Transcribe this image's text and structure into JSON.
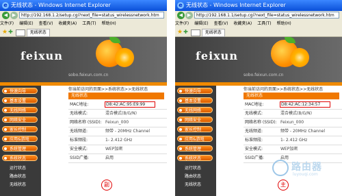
{
  "panels": [
    {
      "window_title": "无线状态 - Windows Internet Explorer",
      "url": "http://192.168.1.2/setup.cgi?next_file=status_wirelessnetwork.htm",
      "menu": [
        "文件(F)",
        "编辑(E)",
        "查看(V)",
        "收藏夹(A)",
        "工具(T)",
        "帮助(H)"
      ],
      "tab_title": "无线状态",
      "logo": "feixun",
      "site": "sobo.feixun.com.cn",
      "breadcrumb": "你当前访问的页面>>系统状态>>无线状态",
      "section_title": "无线状态",
      "rows": [
        {
          "label": "MAC地址:",
          "value": "D8:42:AC:95:E9:99"
        },
        {
          "label": "无线模式:",
          "value": "混合模式(B/G/N)"
        },
        {
          "label": "网络名称 (SSID):",
          "value": "Feixun_000"
        },
        {
          "label": "无线频道:",
          "value": "频带 - 20MHz Channel"
        },
        {
          "label": "标准频段:",
          "value": "1- 2.412 GHz"
        },
        {
          "label": "安全模式:",
          "value": "WEP加密"
        },
        {
          "label": "SSID广播:",
          "value": "启用"
        }
      ],
      "nav": [
        "快速向导",
        "基本设置",
        "无线网络",
        "网络安全",
        "家长控制",
        "应用&游戏",
        "系统管理",
        "系统状态"
      ],
      "sub": [
        "运行状态",
        "路由状态",
        "无线状态"
      ],
      "stamp": "副"
    },
    {
      "window_title": "无线状态 - Windows Internet Explorer",
      "url": "http://192.168.1.1/setup.cgi?next_file=status_wirelessnetwork.htm",
      "menu": [
        "文件(F)",
        "编辑(E)",
        "查看(V)",
        "收藏夹(A)",
        "工具(T)",
        "帮助(H)"
      ],
      "tab_title": "无线状态",
      "logo": "feixun",
      "site": "sobo.feixun.com.cn",
      "breadcrumb": "你当前访问的页面>>系统状态>>无线状态",
      "section_title": "无线状态",
      "rows": [
        {
          "label": "MAC地址:",
          "value": "D8:42:AC:12:34:57"
        },
        {
          "label": "无线模式:",
          "value": "混合模式(B/G/N)"
        },
        {
          "label": "网络名称 (SSID):",
          "value": "Feixun_000"
        },
        {
          "label": "无线频道:",
          "value": "频带 - 20MHz Channel"
        },
        {
          "label": "标准频段:",
          "value": "1- 2.412 GHz"
        },
        {
          "label": "安全模式:",
          "value": "WEP加密"
        },
        {
          "label": "SSID广播:",
          "value": "启用"
        }
      ],
      "nav": [
        "快速向导",
        "基本设置",
        "无线网络",
        "网络安全",
        "家长控制",
        "应用&游戏",
        "系统管理",
        "系统状态"
      ],
      "sub": [
        "运行状态",
        "路由状态",
        "无线状态"
      ],
      "stamp": "主"
    }
  ],
  "watermark": {
    "text": "路由器",
    "sub": "luyouqi.com"
  },
  "colors": {
    "accent": "#f07800",
    "highlight_box": "#e00000",
    "titlebar": "#0a4fd8"
  }
}
